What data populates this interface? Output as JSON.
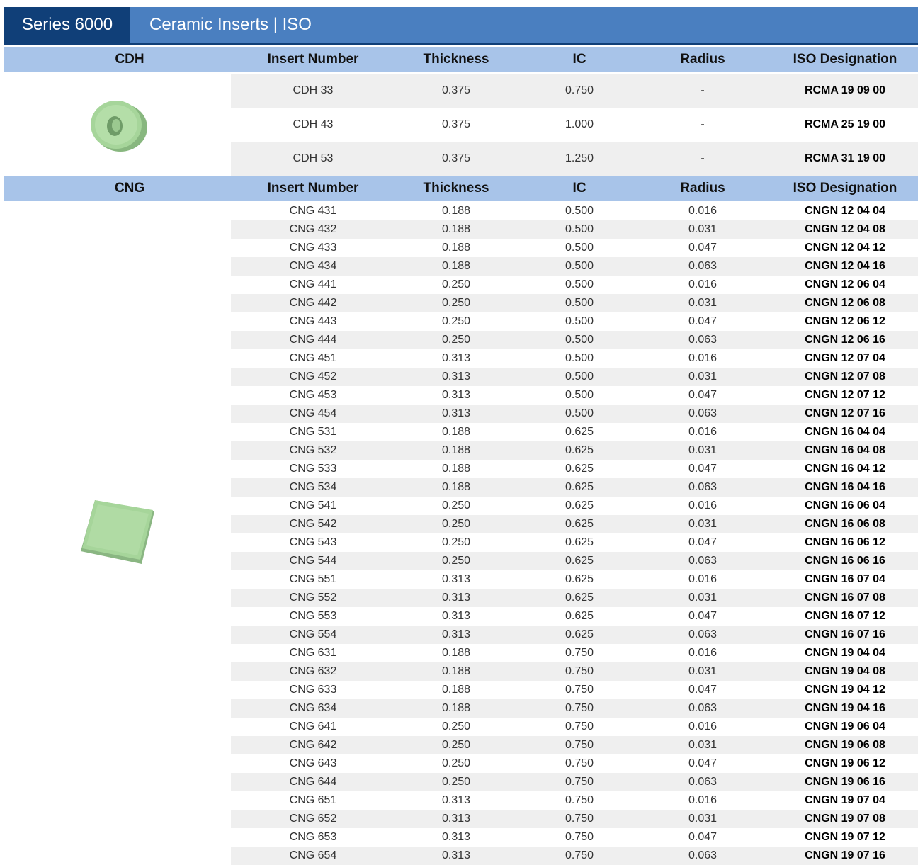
{
  "title": {
    "series": "Series 6000",
    "name": "Ceramic Inserts | ISO"
  },
  "columns": [
    "Insert Number",
    "Thickness",
    "IC",
    "Radius",
    "ISO Designation"
  ],
  "colors": {
    "title_dark": "#103f78",
    "title_light": "#4a7fc0",
    "header_bg": "#a8c4e9",
    "row_alt": "#efefef",
    "insert_green": "#a6d59a"
  },
  "sections": [
    {
      "group": "CDH",
      "image": "round-ceramic-insert-icon",
      "rows": [
        [
          "CDH 33",
          "0.375",
          "0.750",
          "-",
          "RCMA 19 09 00"
        ],
        [
          "CDH 43",
          "0.375",
          "1.000",
          "-",
          "RCMA 25 19 00"
        ],
        [
          "CDH 53",
          "0.375",
          "1.250",
          "-",
          "RCMA 31 19 00"
        ]
      ]
    },
    {
      "group": "CNG",
      "image": "rhombic-ceramic-insert-icon",
      "rows": [
        [
          "CNG 431",
          "0.188",
          "0.500",
          "0.016",
          "CNGN 12 04 04"
        ],
        [
          "CNG 432",
          "0.188",
          "0.500",
          "0.031",
          "CNGN 12 04 08"
        ],
        [
          "CNG 433",
          "0.188",
          "0.500",
          "0.047",
          "CNGN 12 04 12"
        ],
        [
          "CNG 434",
          "0.188",
          "0.500",
          "0.063",
          "CNGN 12 04 16"
        ],
        [
          "CNG 441",
          "0.250",
          "0.500",
          "0.016",
          "CNGN 12 06 04"
        ],
        [
          "CNG 442",
          "0.250",
          "0.500",
          "0.031",
          "CNGN 12 06 08"
        ],
        [
          "CNG 443",
          "0.250",
          "0.500",
          "0.047",
          "CNGN 12 06 12"
        ],
        [
          "CNG 444",
          "0.250",
          "0.500",
          "0.063",
          "CNGN 12 06 16"
        ],
        [
          "CNG 451",
          "0.313",
          "0.500",
          "0.016",
          "CNGN 12 07 04"
        ],
        [
          "CNG 452",
          "0.313",
          "0.500",
          "0.031",
          "CNGN 12 07 08"
        ],
        [
          "CNG 453",
          "0.313",
          "0.500",
          "0.047",
          "CNGN 12 07 12"
        ],
        [
          "CNG 454",
          "0.313",
          "0.500",
          "0.063",
          "CNGN 12 07 16"
        ],
        [
          "CNG 531",
          "0.188",
          "0.625",
          "0.016",
          "CNGN 16 04 04"
        ],
        [
          "CNG 532",
          "0.188",
          "0.625",
          "0.031",
          "CNGN 16 04 08"
        ],
        [
          "CNG 533",
          "0.188",
          "0.625",
          "0.047",
          "CNGN 16 04 12"
        ],
        [
          "CNG 534",
          "0.188",
          "0.625",
          "0.063",
          "CNGN 16 04 16"
        ],
        [
          "CNG 541",
          "0.250",
          "0.625",
          "0.016",
          "CNGN 16 06 04"
        ],
        [
          "CNG 542",
          "0.250",
          "0.625",
          "0.031",
          "CNGN 16 06 08"
        ],
        [
          "CNG 543",
          "0.250",
          "0.625",
          "0.047",
          "CNGN 16 06 12"
        ],
        [
          "CNG 544",
          "0.250",
          "0.625",
          "0.063",
          "CNGN 16 06 16"
        ],
        [
          "CNG 551",
          "0.313",
          "0.625",
          "0.016",
          "CNGN 16 07 04"
        ],
        [
          "CNG 552",
          "0.313",
          "0.625",
          "0.031",
          "CNGN 16 07 08"
        ],
        [
          "CNG 553",
          "0.313",
          "0.625",
          "0.047",
          "CNGN 16 07 12"
        ],
        [
          "CNG 554",
          "0.313",
          "0.625",
          "0.063",
          "CNGN 16 07 16"
        ],
        [
          "CNG 631",
          "0.188",
          "0.750",
          "0.016",
          "CNGN 19 04 04"
        ],
        [
          "CNG 632",
          "0.188",
          "0.750",
          "0.031",
          "CNGN 19 04 08"
        ],
        [
          "CNG 633",
          "0.188",
          "0.750",
          "0.047",
          "CNGN 19 04 12"
        ],
        [
          "CNG 634",
          "0.188",
          "0.750",
          "0.063",
          "CNGN 19 04 16"
        ],
        [
          "CNG 641",
          "0.250",
          "0.750",
          "0.016",
          "CNGN 19 06 04"
        ],
        [
          "CNG 642",
          "0.250",
          "0.750",
          "0.031",
          "CNGN 19 06 08"
        ],
        [
          "CNG 643",
          "0.250",
          "0.750",
          "0.047",
          "CNGN 19 06 12"
        ],
        [
          "CNG 644",
          "0.250",
          "0.750",
          "0.063",
          "CNGN 19 06 16"
        ],
        [
          "CNG 651",
          "0.313",
          "0.750",
          "0.016",
          "CNGN 19 07 04"
        ],
        [
          "CNG 652",
          "0.313",
          "0.750",
          "0.031",
          "CNGN 19 07 08"
        ],
        [
          "CNG 653",
          "0.313",
          "0.750",
          "0.047",
          "CNGN 19 07 12"
        ],
        [
          "CNG 654",
          "0.313",
          "0.750",
          "0.063",
          "CNGN 19 07 16"
        ]
      ]
    }
  ]
}
